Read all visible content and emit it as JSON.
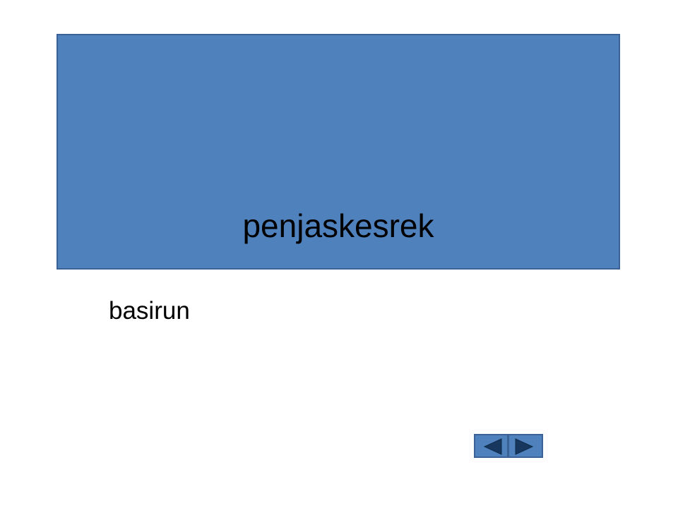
{
  "slide": {
    "title": "penjaskesrek",
    "subtitle": "basirun"
  },
  "navigation": {
    "prev_icon": "triangle-left",
    "next_icon": "triangle-right"
  },
  "colors": {
    "title_box_fill": "#4f81bd",
    "title_box_border": "#3a6296",
    "arrow_fill": "#17375e"
  }
}
